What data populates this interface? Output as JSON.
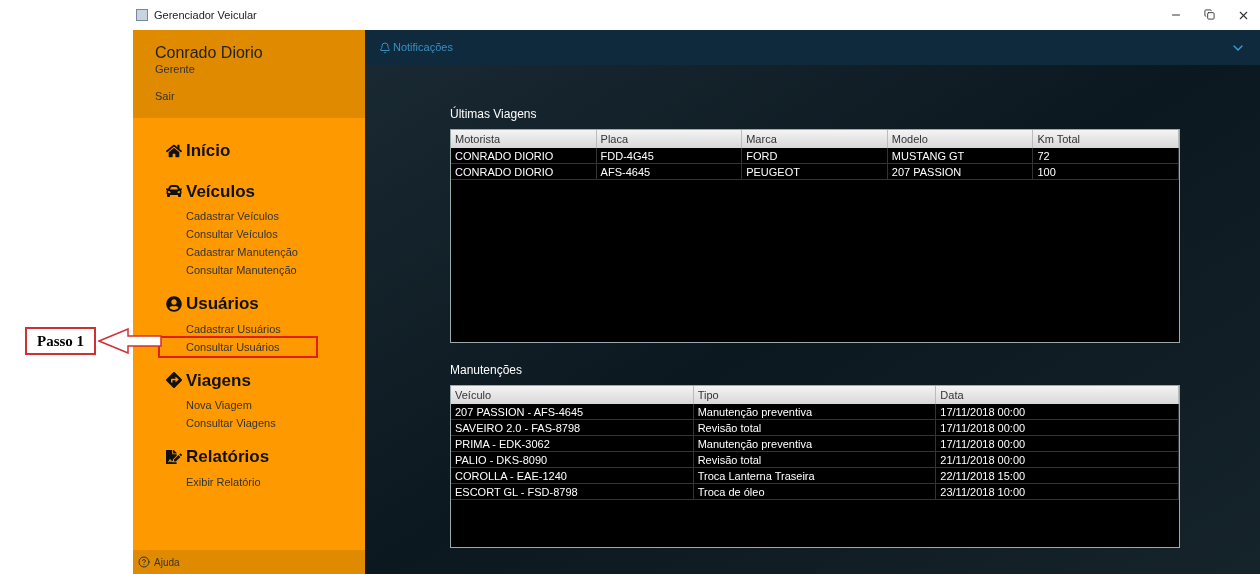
{
  "window": {
    "title": "Gerenciador Veicular"
  },
  "user": {
    "name": "Conrado Diorio",
    "role": "Gerente",
    "logout": "Sair"
  },
  "sidebar": {
    "sections": [
      {
        "title": "Início"
      },
      {
        "title": "Veículos",
        "items": [
          {
            "label": "Cadastrar Veículos",
            "highlighted": false
          },
          {
            "label": "Consultar Veículos",
            "highlighted": false
          },
          {
            "label": "Cadastrar Manutenção",
            "highlighted": false
          },
          {
            "label": "Consultar Manutenção",
            "highlighted": false
          }
        ]
      },
      {
        "title": "Usuários",
        "items": [
          {
            "label": "Cadastrar Usuários",
            "highlighted": false
          },
          {
            "label": "Consultar Usuários",
            "highlighted": true
          }
        ]
      },
      {
        "title": "Viagens",
        "items": [
          {
            "label": "Nova Viagem",
            "highlighted": false
          },
          {
            "label": "Consultar Viagens",
            "highlighted": false
          }
        ]
      },
      {
        "title": "Relatórios",
        "items": [
          {
            "label": "Exibir Relatório",
            "highlighted": false
          }
        ]
      }
    ],
    "help": "Ajuda"
  },
  "annotation": {
    "label": "Passo 1"
  },
  "notifications": {
    "label": "Notificações"
  },
  "trips": {
    "title": "Últimas Viagens",
    "columns": [
      "Motorista",
      "Placa",
      "Marca",
      "Modelo",
      "Km Total"
    ],
    "rows": [
      [
        "CONRADO DIORIO",
        "FDD-4G45",
        "FORD",
        "MUSTANG GT",
        "72"
      ],
      [
        "CONRADO DIORIO",
        "AFS-4645",
        "PEUGEOT",
        "207 PASSION",
        "100"
      ]
    ]
  },
  "maintenance": {
    "title": "Manutenções",
    "columns": [
      "Veículo",
      "Tipo",
      "Data"
    ],
    "rows": [
      [
        "207 PASSION - AFS-4645",
        "Manutenção preventiva",
        "17/11/2018 00:00"
      ],
      [
        "SAVEIRO 2.0 - FAS-8798",
        "Revisão total",
        "17/11/2018 00:00"
      ],
      [
        "PRIMA - EDK-3062",
        "Manutenção preventiva",
        "17/11/2018 00:00"
      ],
      [
        "PALIO - DKS-8090",
        "Revisão total",
        "21/11/2018 00:00"
      ],
      [
        "COROLLA - EAE-1240",
        "Troca Lanterna Traseira",
        "22/11/2018 15:00"
      ],
      [
        "ESCORT GL - FSD-8798",
        "Troca de óleo",
        "23/11/2018 10:00"
      ]
    ]
  }
}
